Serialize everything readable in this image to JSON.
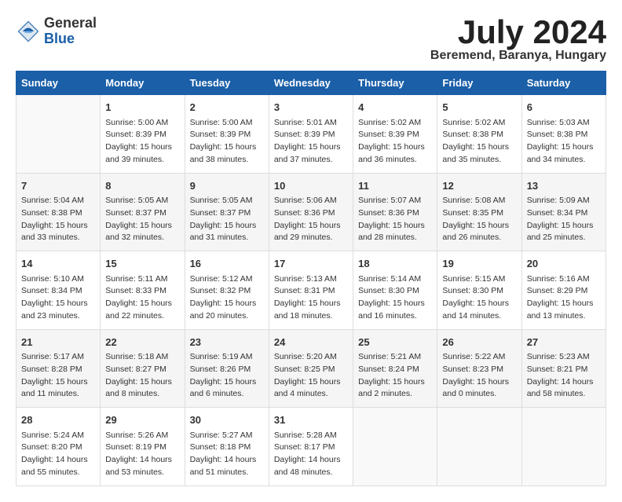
{
  "header": {
    "logo_general": "General",
    "logo_blue": "Blue",
    "month_title": "July 2024",
    "location": "Beremend, Baranya, Hungary"
  },
  "days_of_week": [
    "Sunday",
    "Monday",
    "Tuesday",
    "Wednesday",
    "Thursday",
    "Friday",
    "Saturday"
  ],
  "weeks": [
    [
      {
        "day": "",
        "info": ""
      },
      {
        "day": "1",
        "info": "Sunrise: 5:00 AM\nSunset: 8:39 PM\nDaylight: 15 hours\nand 39 minutes."
      },
      {
        "day": "2",
        "info": "Sunrise: 5:00 AM\nSunset: 8:39 PM\nDaylight: 15 hours\nand 38 minutes."
      },
      {
        "day": "3",
        "info": "Sunrise: 5:01 AM\nSunset: 8:39 PM\nDaylight: 15 hours\nand 37 minutes."
      },
      {
        "day": "4",
        "info": "Sunrise: 5:02 AM\nSunset: 8:39 PM\nDaylight: 15 hours\nand 36 minutes."
      },
      {
        "day": "5",
        "info": "Sunrise: 5:02 AM\nSunset: 8:38 PM\nDaylight: 15 hours\nand 35 minutes."
      },
      {
        "day": "6",
        "info": "Sunrise: 5:03 AM\nSunset: 8:38 PM\nDaylight: 15 hours\nand 34 minutes."
      }
    ],
    [
      {
        "day": "7",
        "info": "Sunrise: 5:04 AM\nSunset: 8:38 PM\nDaylight: 15 hours\nand 33 minutes."
      },
      {
        "day": "8",
        "info": "Sunrise: 5:05 AM\nSunset: 8:37 PM\nDaylight: 15 hours\nand 32 minutes."
      },
      {
        "day": "9",
        "info": "Sunrise: 5:05 AM\nSunset: 8:37 PM\nDaylight: 15 hours\nand 31 minutes."
      },
      {
        "day": "10",
        "info": "Sunrise: 5:06 AM\nSunset: 8:36 PM\nDaylight: 15 hours\nand 29 minutes."
      },
      {
        "day": "11",
        "info": "Sunrise: 5:07 AM\nSunset: 8:36 PM\nDaylight: 15 hours\nand 28 minutes."
      },
      {
        "day": "12",
        "info": "Sunrise: 5:08 AM\nSunset: 8:35 PM\nDaylight: 15 hours\nand 26 minutes."
      },
      {
        "day": "13",
        "info": "Sunrise: 5:09 AM\nSunset: 8:34 PM\nDaylight: 15 hours\nand 25 minutes."
      }
    ],
    [
      {
        "day": "14",
        "info": "Sunrise: 5:10 AM\nSunset: 8:34 PM\nDaylight: 15 hours\nand 23 minutes."
      },
      {
        "day": "15",
        "info": "Sunrise: 5:11 AM\nSunset: 8:33 PM\nDaylight: 15 hours\nand 22 minutes."
      },
      {
        "day": "16",
        "info": "Sunrise: 5:12 AM\nSunset: 8:32 PM\nDaylight: 15 hours\nand 20 minutes."
      },
      {
        "day": "17",
        "info": "Sunrise: 5:13 AM\nSunset: 8:31 PM\nDaylight: 15 hours\nand 18 minutes."
      },
      {
        "day": "18",
        "info": "Sunrise: 5:14 AM\nSunset: 8:30 PM\nDaylight: 15 hours\nand 16 minutes."
      },
      {
        "day": "19",
        "info": "Sunrise: 5:15 AM\nSunset: 8:30 PM\nDaylight: 15 hours\nand 14 minutes."
      },
      {
        "day": "20",
        "info": "Sunrise: 5:16 AM\nSunset: 8:29 PM\nDaylight: 15 hours\nand 13 minutes."
      }
    ],
    [
      {
        "day": "21",
        "info": "Sunrise: 5:17 AM\nSunset: 8:28 PM\nDaylight: 15 hours\nand 11 minutes."
      },
      {
        "day": "22",
        "info": "Sunrise: 5:18 AM\nSunset: 8:27 PM\nDaylight: 15 hours\nand 8 minutes."
      },
      {
        "day": "23",
        "info": "Sunrise: 5:19 AM\nSunset: 8:26 PM\nDaylight: 15 hours\nand 6 minutes."
      },
      {
        "day": "24",
        "info": "Sunrise: 5:20 AM\nSunset: 8:25 PM\nDaylight: 15 hours\nand 4 minutes."
      },
      {
        "day": "25",
        "info": "Sunrise: 5:21 AM\nSunset: 8:24 PM\nDaylight: 15 hours\nand 2 minutes."
      },
      {
        "day": "26",
        "info": "Sunrise: 5:22 AM\nSunset: 8:23 PM\nDaylight: 15 hours\nand 0 minutes."
      },
      {
        "day": "27",
        "info": "Sunrise: 5:23 AM\nSunset: 8:21 PM\nDaylight: 14 hours\nand 58 minutes."
      }
    ],
    [
      {
        "day": "28",
        "info": "Sunrise: 5:24 AM\nSunset: 8:20 PM\nDaylight: 14 hours\nand 55 minutes."
      },
      {
        "day": "29",
        "info": "Sunrise: 5:26 AM\nSunset: 8:19 PM\nDaylight: 14 hours\nand 53 minutes."
      },
      {
        "day": "30",
        "info": "Sunrise: 5:27 AM\nSunset: 8:18 PM\nDaylight: 14 hours\nand 51 minutes."
      },
      {
        "day": "31",
        "info": "Sunrise: 5:28 AM\nSunset: 8:17 PM\nDaylight: 14 hours\nand 48 minutes."
      },
      {
        "day": "",
        "info": ""
      },
      {
        "day": "",
        "info": ""
      },
      {
        "day": "",
        "info": ""
      }
    ]
  ]
}
